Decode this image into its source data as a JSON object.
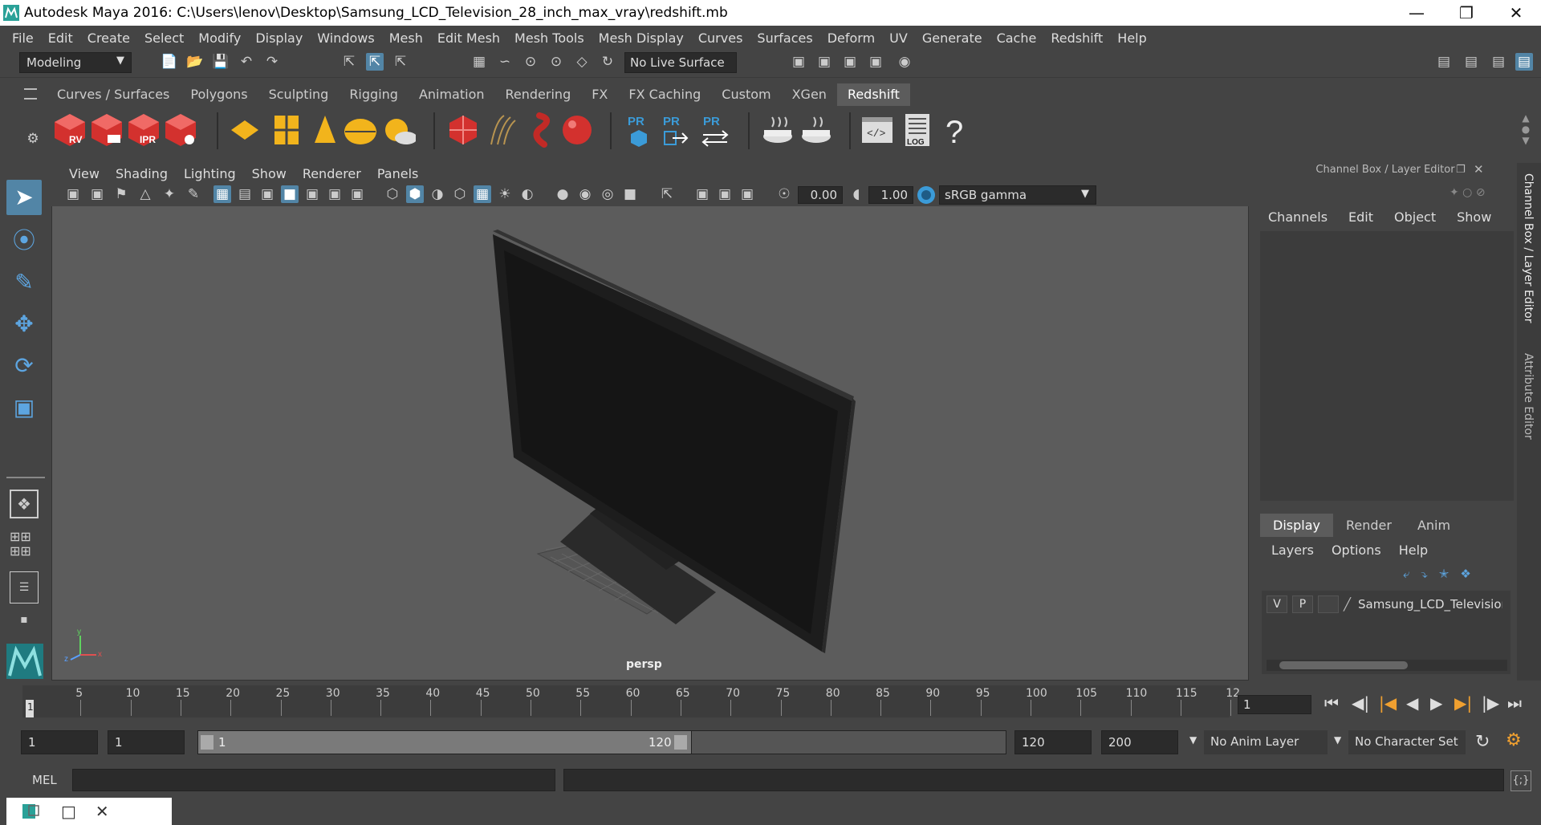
{
  "window": {
    "title": "Autodesk Maya 2016: C:\\Users\\lenov\\Desktop\\Samsung_LCD_Television_28_inch_max_vray\\redshift.mb"
  },
  "menubar": [
    "File",
    "Edit",
    "Create",
    "Select",
    "Modify",
    "Display",
    "Windows",
    "Mesh",
    "Edit Mesh",
    "Mesh Tools",
    "Mesh Display",
    "Curves",
    "Surfaces",
    "Deform",
    "UV",
    "Generate",
    "Cache",
    "Redshift",
    "Help"
  ],
  "statusline": {
    "mode": "Modeling",
    "live_surface": "No Live Surface"
  },
  "shelf": {
    "tabs": [
      "Curves / Surfaces",
      "Polygons",
      "Sculpting",
      "Rigging",
      "Animation",
      "Rendering",
      "FX",
      "FX Caching",
      "Custom",
      "XGen",
      "Redshift"
    ],
    "active": "Redshift",
    "icon_labels": [
      "RV",
      "IPR",
      "PR",
      "PR",
      "PR",
      "LOG",
      "?"
    ]
  },
  "viewport": {
    "menu": [
      "View",
      "Shading",
      "Lighting",
      "Show",
      "Renderer",
      "Panels"
    ],
    "exposure": "0.00",
    "gamma_value": "1.00",
    "color_space": "sRGB gamma",
    "camera": "persp"
  },
  "channel_box": {
    "title": "Channel Box / Layer Editor",
    "menu": [
      "Channels",
      "Edit",
      "Object",
      "Show"
    ]
  },
  "side_tabs": [
    "Channel Box / Layer Editor",
    "Attribute Editor"
  ],
  "layer_editor": {
    "tabs": [
      "Display",
      "Render",
      "Anim"
    ],
    "active": "Display",
    "menu": [
      "Layers",
      "Options",
      "Help"
    ],
    "layers": [
      {
        "v": "V",
        "p": "P",
        "name": "Samsung_LCD_Televisior"
      }
    ]
  },
  "timeline": {
    "ticks": [
      "1",
      "5",
      "10",
      "15",
      "20",
      "25",
      "30",
      "35",
      "40",
      "45",
      "50",
      "55",
      "60",
      "65",
      "70",
      "75",
      "80",
      "85",
      "90",
      "95",
      "100",
      "105",
      "110",
      "115",
      "12"
    ],
    "current_frame": "1"
  },
  "range": {
    "start": "1",
    "playback_start": "1",
    "slider_start": "1",
    "slider_end": "120",
    "playback_end": "120",
    "end": "200",
    "anim_layer": "No Anim Layer",
    "character_set": "No Character Set"
  },
  "command": {
    "label": "MEL"
  }
}
